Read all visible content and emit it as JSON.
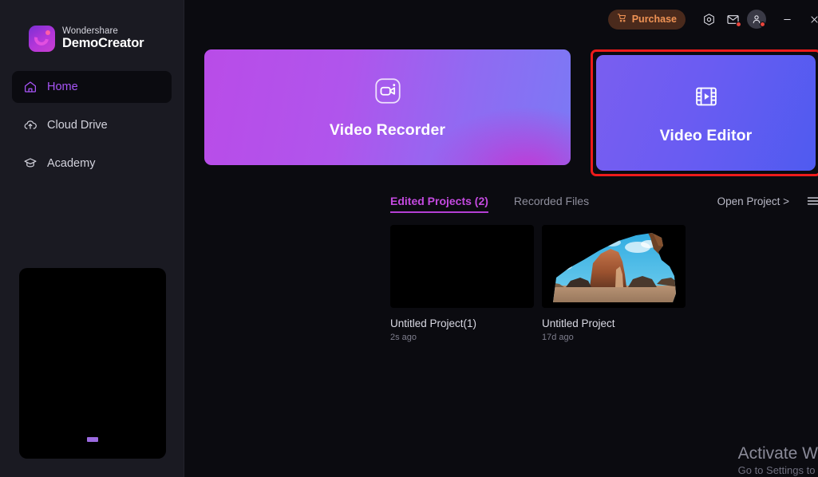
{
  "brand": {
    "top_line": "Wondershare",
    "bottom_line": "DemoCreator",
    "logo_icon": "democreator-logo-icon"
  },
  "sidebar": {
    "items": [
      {
        "label": "Home",
        "icon": "home-icon",
        "active": true
      },
      {
        "label": "Cloud Drive",
        "icon": "cloud-upload-icon",
        "active": false
      },
      {
        "label": "Academy",
        "icon": "graduation-cap-icon",
        "active": false
      }
    ],
    "promo_panel": {
      "name": "promo-banner",
      "content": ""
    }
  },
  "topbar": {
    "purchase_label": "Purchase",
    "purchase_icon": "shopping-cart-icon",
    "settings_icon": "settings-hexagon-icon",
    "mail_icon": "mail-icon",
    "mail_has_badge": true,
    "account_icon": "user-avatar-icon",
    "account_has_badge": true,
    "minimize_icon": "minimize-icon",
    "close_icon": "close-icon"
  },
  "hero_cards": [
    {
      "title": "Video Recorder",
      "icon": "video-camera-icon",
      "highlighted": false
    },
    {
      "title": "Video Editor",
      "icon": "film-strip-play-icon",
      "highlighted": true
    }
  ],
  "tabs": [
    {
      "label": "Edited Projects (2)",
      "active": true
    },
    {
      "label": "Recorded Files",
      "active": false
    }
  ],
  "actions": {
    "open_project_label": "Open Project >",
    "menu_icon": "hamburger-menu-icon"
  },
  "projects": [
    {
      "name": "Untitled Project(1)",
      "time": "2s ago",
      "thumbnail": "black-empty-thumbnail"
    },
    {
      "name": "Untitled Project",
      "time": "17d ago",
      "thumbnail": "desert-arch-cave-thumbnail"
    }
  ],
  "watermark": {
    "line1": "Activate Wind",
    "line2": "Go to Settings to"
  },
  "colors": {
    "accent_purple": "#a855f7",
    "tab_active": "#c44ae0",
    "highlight_border": "#ee1b1b",
    "purchase_text": "#ef9355",
    "badge_red": "#e8453c",
    "sidebar_bg": "#1a1a22",
    "main_bg": "#0b0b10"
  }
}
